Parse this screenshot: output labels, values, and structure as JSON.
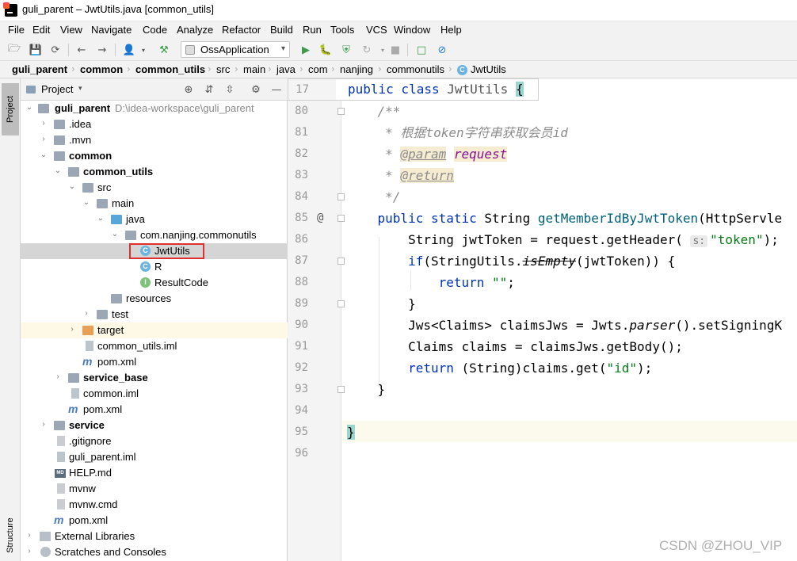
{
  "window": {
    "title": "guli_parent – JwtUtils.java [common_utils]"
  },
  "menu": [
    "File",
    "Edit",
    "View",
    "Navigate",
    "Code",
    "Analyze",
    "Refactor",
    "Build",
    "Run",
    "Tools",
    "VCS",
    "Window",
    "Help"
  ],
  "toolbar": {
    "run_config": "OssApplication"
  },
  "breadcrumb": [
    "guli_parent",
    "common",
    "common_utils",
    "src",
    "main",
    "java",
    "com",
    "nanjing",
    "commonutils",
    "JwtUtils"
  ],
  "left_stripe": {
    "project_tab": "Project",
    "structure_tab": "Structure"
  },
  "project_panel": {
    "title": "Project",
    "tree": [
      {
        "label": "guli_parent",
        "path": "D:\\idea-workspace\\guli_parent",
        "icon": "module-folder-icon",
        "arrow": "expanded",
        "bold": true
      },
      {
        "label": ".idea",
        "icon": "folder-icon",
        "arrow": "collapsed"
      },
      {
        "label": ".mvn",
        "icon": "folder-icon",
        "arrow": "collapsed"
      },
      {
        "label": "common",
        "icon": "module-folder-icon",
        "arrow": "expanded",
        "bold": true
      },
      {
        "label": "common_utils",
        "icon": "module-folder-icon",
        "arrow": "expanded",
        "bold": true
      },
      {
        "label": "src",
        "icon": "folder-icon",
        "arrow": "expanded"
      },
      {
        "label": "main",
        "icon": "folder-icon",
        "arrow": "expanded"
      },
      {
        "label": "java",
        "icon": "source-folder-icon",
        "arrow": "expanded"
      },
      {
        "label": "com.nanjing.commonutils",
        "icon": "package-icon",
        "arrow": "expanded"
      },
      {
        "label": "JwtUtils",
        "icon": "class-icon",
        "selected": true
      },
      {
        "label": "R",
        "icon": "class-icon"
      },
      {
        "label": "ResultCode",
        "icon": "interface-icon"
      },
      {
        "label": "resources",
        "icon": "resources-folder-icon"
      },
      {
        "label": "test",
        "icon": "folder-icon",
        "arrow": "collapsed"
      },
      {
        "label": "target",
        "icon": "excluded-folder-icon",
        "arrow": "collapsed"
      },
      {
        "label": "common_utils.iml",
        "icon": "iml-file-icon"
      },
      {
        "label": "pom.xml",
        "icon": "maven-icon"
      },
      {
        "label": "service_base",
        "icon": "module-folder-icon",
        "arrow": "collapsed",
        "bold": true
      },
      {
        "label": "common.iml",
        "icon": "iml-file-icon"
      },
      {
        "label": "pom.xml",
        "icon": "maven-icon"
      },
      {
        "label": "service",
        "icon": "module-folder-icon",
        "arrow": "collapsed",
        "bold": true
      },
      {
        "label": ".gitignore",
        "icon": "text-file-icon"
      },
      {
        "label": "guli_parent.iml",
        "icon": "iml-file-icon"
      },
      {
        "label": "HELP.md",
        "icon": "markdown-file-icon"
      },
      {
        "label": "mvnw",
        "icon": "text-file-icon"
      },
      {
        "label": "mvnw.cmd",
        "icon": "text-file-icon"
      },
      {
        "label": "pom.xml",
        "icon": "maven-icon"
      },
      {
        "label": "External Libraries",
        "icon": "library-icon",
        "arrow": "collapsed"
      },
      {
        "label": "Scratches and Consoles",
        "icon": "scratches-icon",
        "arrow": "collapsed"
      }
    ]
  },
  "editor": {
    "sticky": {
      "line": "17",
      "code": "public class JwtUtils {"
    },
    "lines": [
      {
        "no": "80",
        "text": "    /**"
      },
      {
        "no": "81",
        "text": "     * 根据token字符串获取会员id"
      },
      {
        "no": "82",
        "text": "     * @param request"
      },
      {
        "no": "83",
        "text": "     * @return"
      },
      {
        "no": "84",
        "text": "     */"
      },
      {
        "no": "85",
        "text": "    public static String getMemberIdByJwtToken(HttpServle"
      },
      {
        "no": "86",
        "text": "        String jwtToken = request.getHeader( s: \"token\");"
      },
      {
        "no": "87",
        "text": "        if(StringUtils.isEmpty(jwtToken)) {"
      },
      {
        "no": "88",
        "text": "            return \"\";"
      },
      {
        "no": "89",
        "text": "        }"
      },
      {
        "no": "90",
        "text": "        Jws<Claims> claimsJws = Jwts.parser().setSigningK"
      },
      {
        "no": "91",
        "text": "        Claims claims = claimsJws.getBody();"
      },
      {
        "no": "92",
        "text": "        return (String)claims.get(\"id\");"
      },
      {
        "no": "93",
        "text": "    }"
      },
      {
        "no": "94",
        "text": ""
      },
      {
        "no": "95",
        "text": "}"
      },
      {
        "no": "96",
        "text": ""
      }
    ]
  },
  "watermark": "CSDN @ZHOU_VIP"
}
